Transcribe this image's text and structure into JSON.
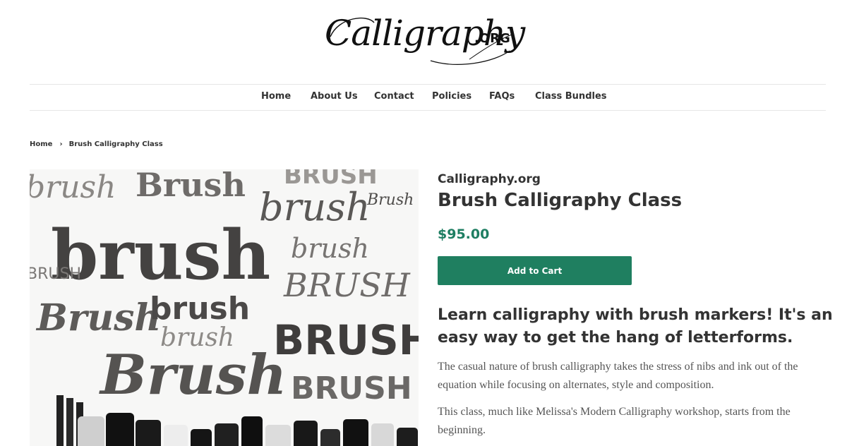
{
  "brand": {
    "script": "Calligraphy",
    "suffix": ".ORG"
  },
  "nav": {
    "items": [
      "Home",
      "About Us",
      "Contact",
      "Policies",
      "FAQs",
      "Class Bundles"
    ]
  },
  "breadcrumb": {
    "home": "Home",
    "separator": "›",
    "current": "Brush Calligraphy Class"
  },
  "product": {
    "vendor": "Calligraphy.org",
    "title": "Brush Calligraphy Class",
    "price": "$95.00",
    "add_to_cart": "Add to Cart",
    "description_heading": "Learn calligraphy with brush markers! It's an easy way to get the hang of letterforms.",
    "paragraphs": [
      "The casual nature of brush calligraphy takes the stress of nibs and ink out of the equation while focusing on alternates, style and composition.",
      "This class, much like Melissa's Modern Calligraphy workshop, starts from the beginning."
    ]
  },
  "image": {
    "words": [
      "brush",
      "Brush",
      "BRUSH",
      "brush",
      "Brush",
      "brush",
      "BRUSH",
      "brush",
      "BRUSH",
      "Brush",
      "brush",
      "BRUSH",
      "brush",
      "Brush",
      "BRUSH"
    ]
  },
  "colors": {
    "accent": "#1f7f60",
    "price": "#1e7e62"
  }
}
